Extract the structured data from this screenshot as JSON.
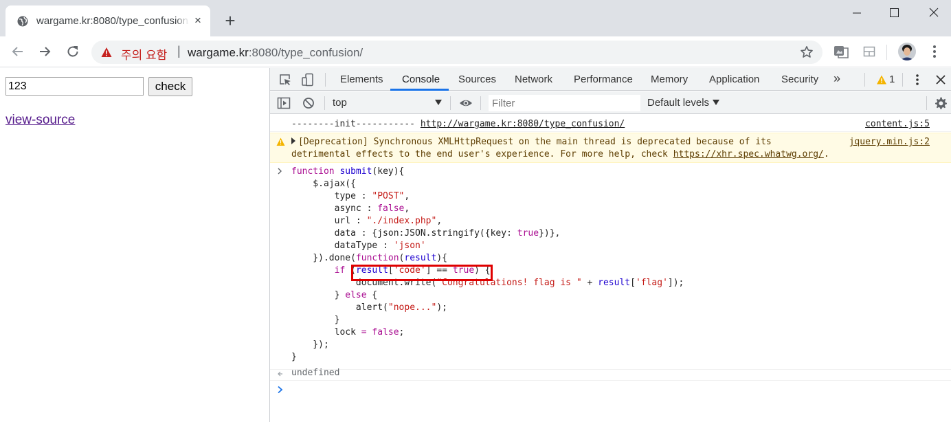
{
  "browser": {
    "tab_title": "wargame.kr:8080/type_confusion/",
    "tab_close_label": "×",
    "new_tab_label": "+",
    "omnibox": {
      "security_warning": "주의 요함",
      "separator": "|",
      "url_host": "wargame.kr",
      "url_rest": ":8080/type_confusion/"
    }
  },
  "page": {
    "key_input_value": "123",
    "check_button": "check",
    "view_source_link": "view-source"
  },
  "devtools": {
    "tabs": [
      "Elements",
      "Console",
      "Sources",
      "Network",
      "Performance",
      "Memory",
      "Application",
      "Security"
    ],
    "active_tab": "Console",
    "more_tabs": "»",
    "warning_count": "1",
    "context": "top",
    "filter_placeholder": "Filter",
    "levels": "Default levels",
    "colors": {
      "accent": "#1a73e8",
      "warning_bg": "#fffbe5",
      "highlight_box": "#e00000"
    },
    "console": {
      "init_message": "--------init----------- ",
      "init_url": "http://wargame.kr:8080/type_confusion/",
      "init_source": "content.js:5",
      "deprecation_line1": "[Deprecation] Synchronous XMLHttpRequest on the main thread is deprecated because of its",
      "deprecation_line2": "detrimental effects to the end user's experience. For more help, check ",
      "deprecation_url": "https://xhr.spec.whatwg.org/",
      "deprecation_end": ".",
      "deprecation_source": "jquery.min.js:2",
      "result": "undefined"
    }
  }
}
